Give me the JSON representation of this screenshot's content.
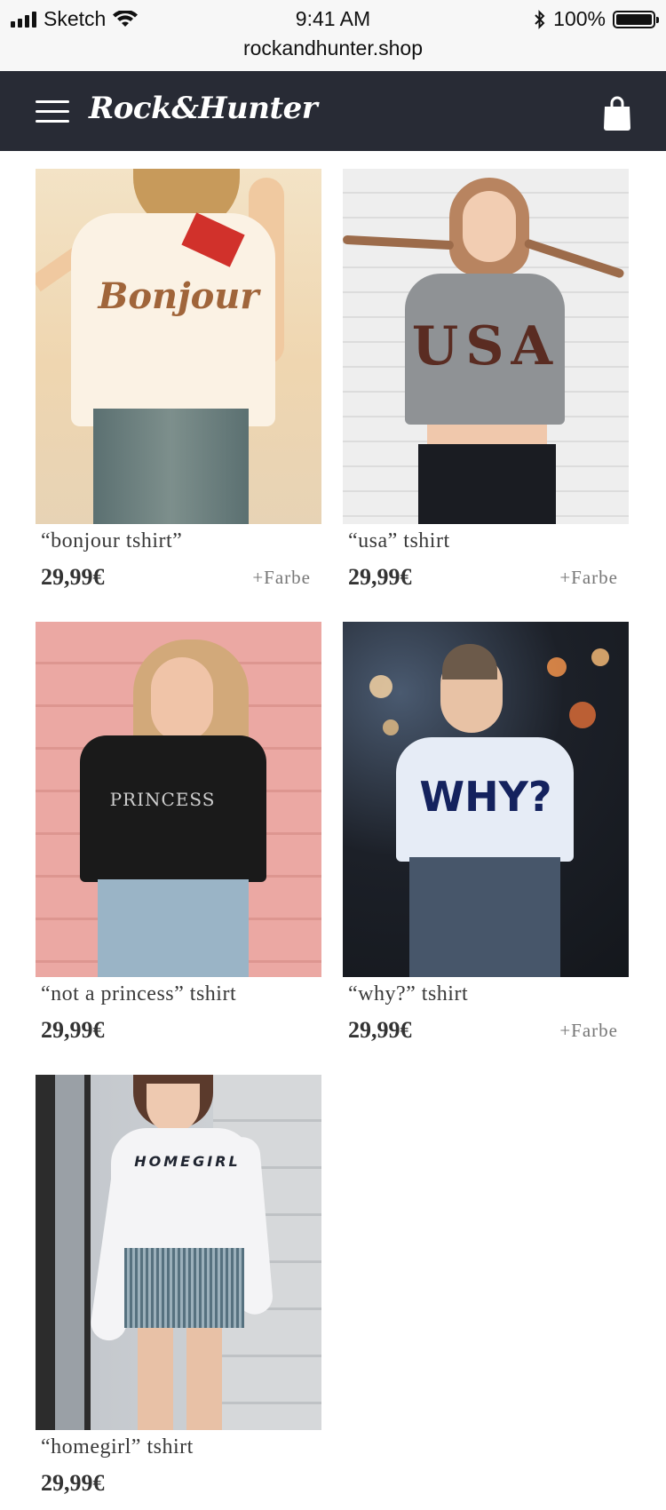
{
  "status_bar": {
    "carrier": "Sketch",
    "time": "9:41 AM",
    "url": "rockandhunter.shop",
    "battery": "100%"
  },
  "nav": {
    "brand": "Rock&Hunter",
    "icons": [
      "hamburger-menu-icon",
      "shopping-bag-icon"
    ]
  },
  "products": [
    {
      "name": "“bonjour tshirt”",
      "price": "29,99€",
      "color_option": "+Farbe",
      "shirt_print": "Bonjour"
    },
    {
      "name": "“usa” tshirt",
      "price": "29,99€",
      "color_option": "+Farbe",
      "shirt_print": "USA"
    },
    {
      "name": "“not a princess” tshirt",
      "price": "29,99€",
      "shirt_print": "PRINCESS"
    },
    {
      "name": "“why?” tshirt",
      "price": "29,99€",
      "color_option": "+Farbe",
      "shirt_print": "WHY?"
    },
    {
      "name": "“homegirl” tshirt",
      "price": "29,99€",
      "shirt_print": "HOMEGIRL"
    }
  ],
  "colors": {
    "nav_bg": "#282b35",
    "status_bg": "#f7f7f7"
  }
}
